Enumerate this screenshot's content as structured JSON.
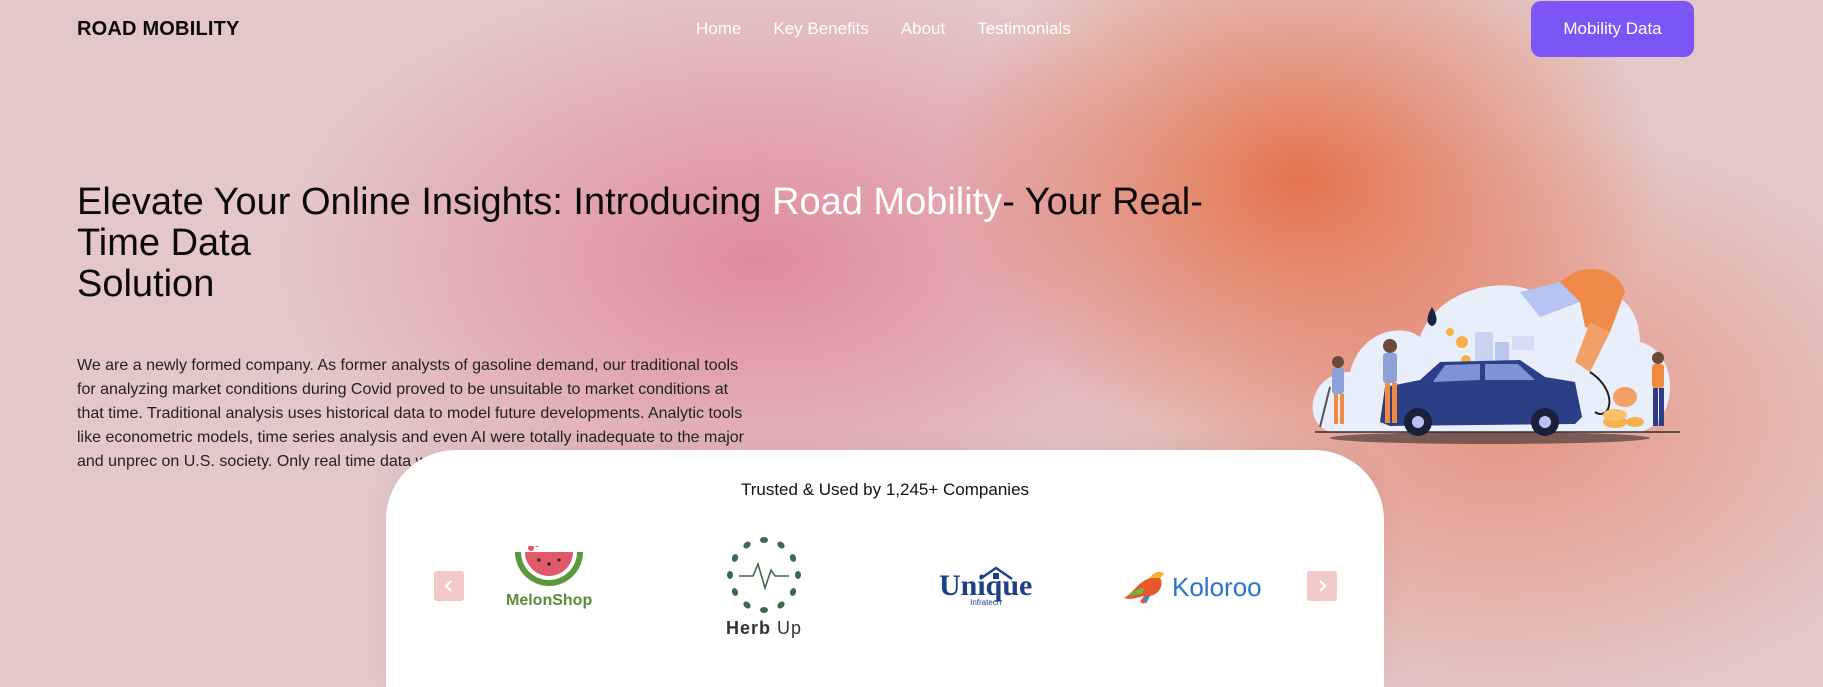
{
  "header": {
    "brand": "ROAD MOBILITY",
    "nav": [
      "Home",
      "Key Benefits",
      "About",
      "Testimonials"
    ],
    "cta_label": "Mobility Data"
  },
  "hero": {
    "title_part1": "Elevate Your Online Insights: Introducing ",
    "title_highlight": "Road Mobility",
    "title_part2": "- Your Real-Time Data",
    "title_line3": "Solution",
    "body": "We are a newly formed company. As former analysts of gasoline demand, our traditional tools for analyzing market conditions during Covid proved to be unsuitable to market conditions at that time. Traditional analysis uses historical data to model future developments. Analytic tools like econometric models, time series analysis and even AI were totally inadequate to the major and unprec on U.S. society. Only real time data would p history."
  },
  "trusted": {
    "title": "Trusted & Used by 1,245+ Companies",
    "logos": [
      {
        "name": "MelonShop",
        "icon": "watermelon-icon"
      },
      {
        "name_bold": "Herb",
        "name_light": " Up",
        "icon": "herb-wreath-icon"
      },
      {
        "name": "Unique",
        "sub": "Infratech",
        "icon": "house-icon"
      },
      {
        "name": "Koloroo",
        "icon": "kangaroo-icon"
      }
    ]
  },
  "colors": {
    "accent": "#7b55f5",
    "highlight": "#ffffff",
    "arrow_bg": "#f2c9c6"
  }
}
